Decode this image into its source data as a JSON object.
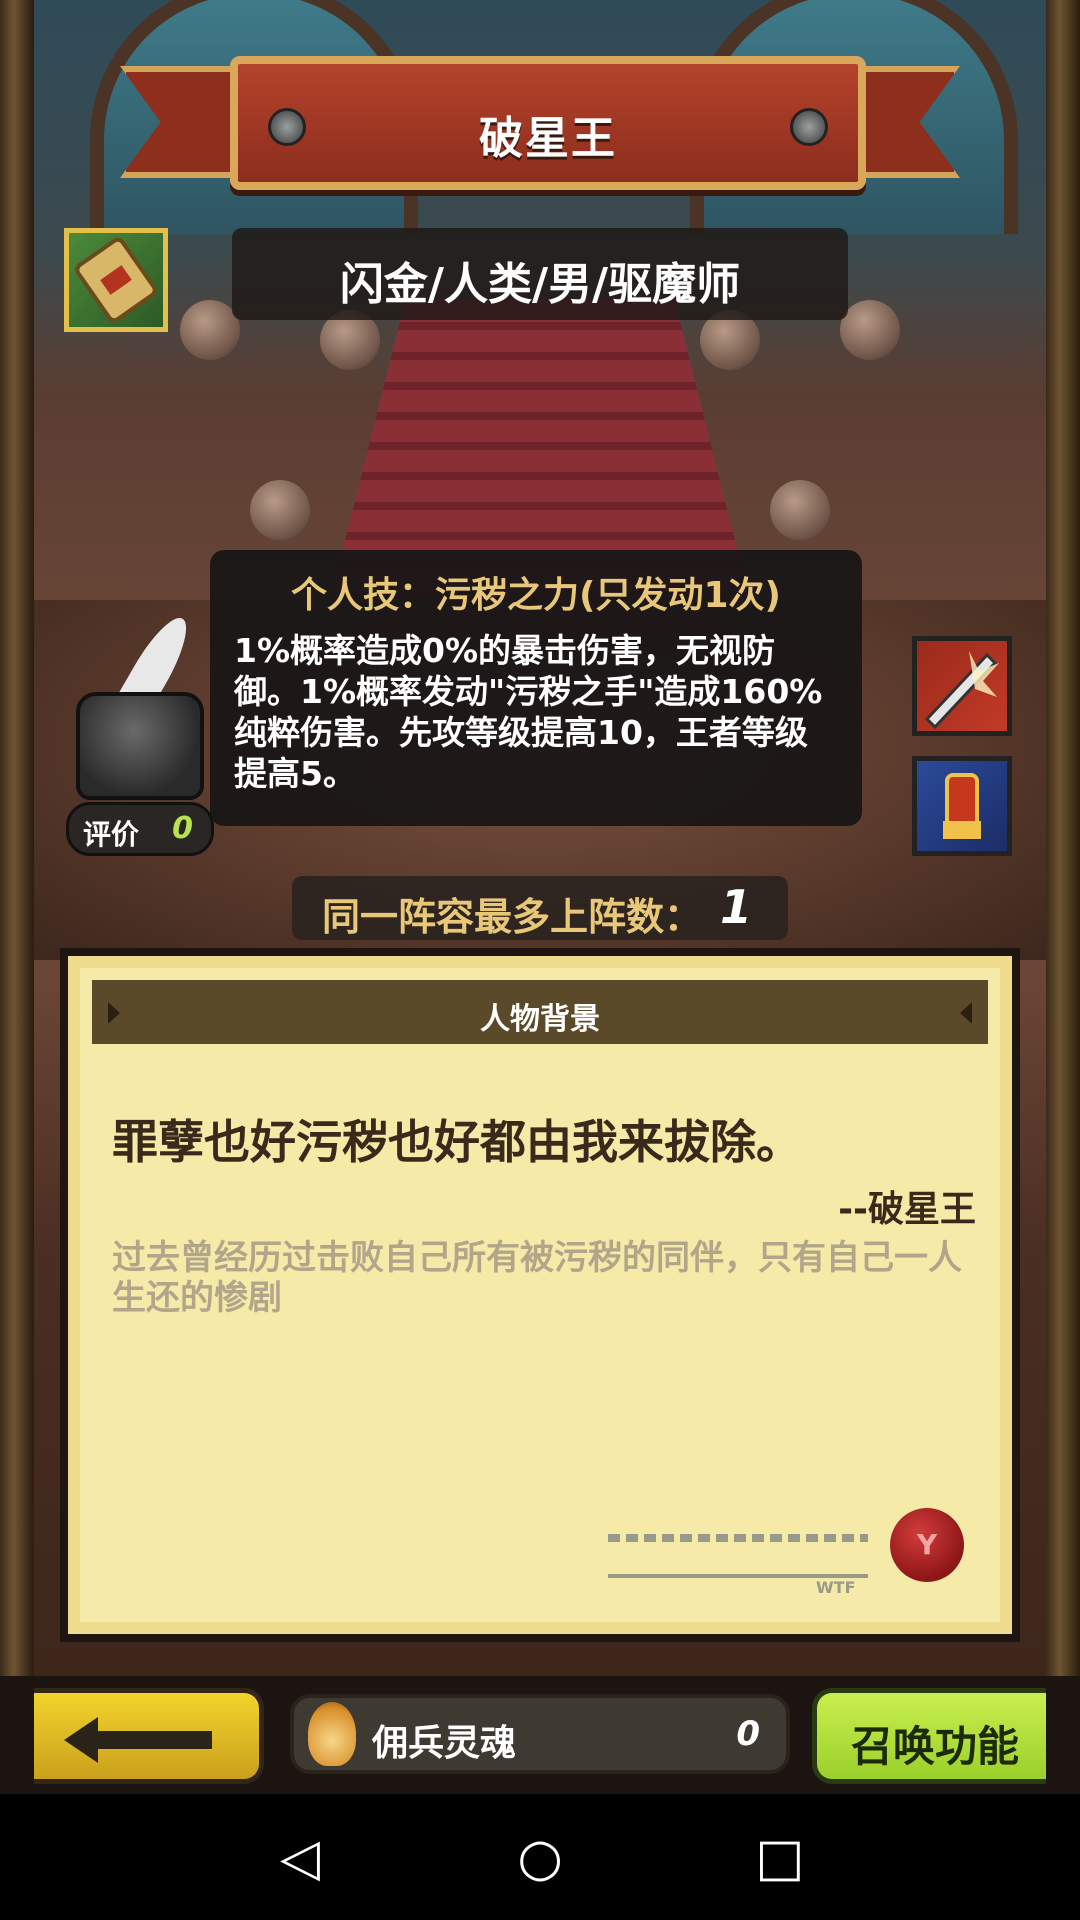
{
  "hero": {
    "name": "破星王",
    "class_line": "闪金/人类/男/驱魔师",
    "rating_label": "评价",
    "rating_value": "0"
  },
  "skill": {
    "title": "个人技：污秽之力(只发动1次)",
    "description": "1%概率造成0%的暴击伤害，无视防御。1%概率发动\"污秽之手\"造成160%纯粹伤害。先攻等级提高10，王者等级提高5。"
  },
  "team_limit": {
    "label": "同一阵容最多上阵数：",
    "value": "1"
  },
  "background": {
    "header": "人物背景",
    "quote": "罪孽也好污秽也好都由我来拔除。",
    "author": "--破星王",
    "story": "过去曾经历过击败自己所有被污秽的同伴，只有自己一人生还的惨剧",
    "signature_tag": "WTF",
    "seal_mark": "Y"
  },
  "bottom_bar": {
    "soul_label": "佣兵灵魂",
    "soul_value": "0",
    "summon_label": "召唤功能",
    "back_icon": "left-arrow-icon"
  },
  "icons": {
    "class_icon": "scroll-icon",
    "slot_1": "sword-slash-icon",
    "slot_2": "gauntlet-icon",
    "ink": "inkwell-quill-icon"
  },
  "nav": {
    "back_glyph": "◁",
    "home_glyph": "○",
    "recents_glyph": "□"
  },
  "colors": {
    "accent_gold": "#e8c779",
    "summon_green": "#9bd02a",
    "back_yellow": "#f2d42c"
  }
}
